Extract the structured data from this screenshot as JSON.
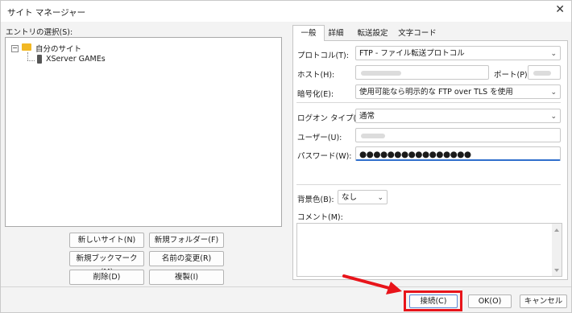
{
  "window": {
    "title": "サイト マネージャー"
  },
  "left": {
    "entries_label": "エントリの選択(S):",
    "tree": {
      "root": "自分のサイト",
      "child": "XServer GAMEs"
    },
    "buttons": {
      "new_site": "新しいサイト(N)",
      "new_folder": "新規フォルダー(F)",
      "new_bookmark": "新規ブックマーク(M)",
      "rename": "名前の変更(R)",
      "delete": "削除(D)",
      "duplicate": "複製(I)"
    }
  },
  "tabs": [
    "一般",
    "詳細",
    "転送設定",
    "文字コード"
  ],
  "form": {
    "protocol_label": "プロトコル(T):",
    "protocol_value": "FTP - ファイル転送プロトコル",
    "host_label": "ホスト(H):",
    "port_label": "ポート(P):",
    "encryption_label": "暗号化(E):",
    "encryption_value": "使用可能なら明示的な FTP over TLS を使用",
    "logon_label": "ログオン タイプ(L):",
    "logon_value": "通常",
    "user_label": "ユーザー(U):",
    "password_label": "パスワード(W):",
    "password_value": "●●●●●●●●●●●●●●●●",
    "bgcolor_label": "背景色(B):",
    "bgcolor_value": "なし",
    "comment_label": "コメント(M):"
  },
  "footer": {
    "connect": "接続(C)",
    "ok": "OK(O)",
    "cancel": "キャンセル"
  },
  "colors": {
    "highlight": "#e8141a",
    "focus": "#2f6fcc"
  },
  "icons": [
    "close-icon",
    "folder-icon",
    "server-icon",
    "chevron-down-icon",
    "arrow-icon"
  ]
}
